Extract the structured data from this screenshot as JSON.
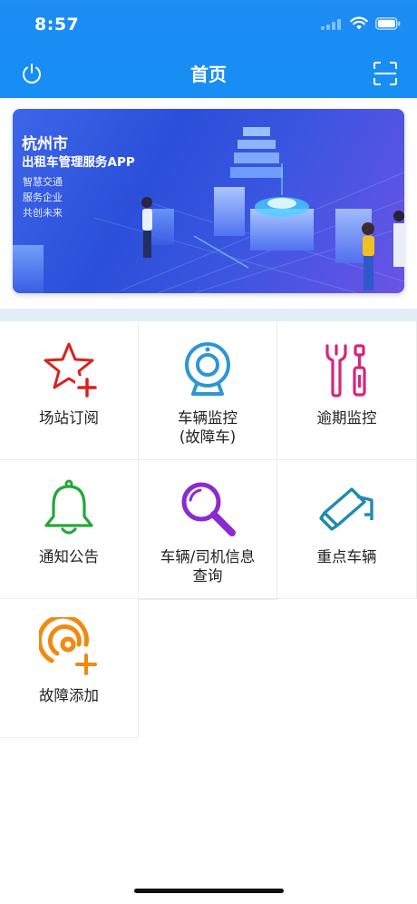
{
  "status_bar": {
    "time": "8:57"
  },
  "nav": {
    "title": "首页",
    "left_icon": "power-icon",
    "right_icon": "scan-icon"
  },
  "banner": {
    "title": "杭州市",
    "subtitle": "出租车管理服务APP",
    "lines": [
      "智慧交通",
      "服务企业",
      "共创未来"
    ]
  },
  "menu": [
    {
      "label": "场站订阅",
      "icon": "star-plus-icon",
      "color": "#d8231c"
    },
    {
      "label": "车辆监控\n(故障车)",
      "icon": "camera-icon",
      "color": "#2c97d4"
    },
    {
      "label": "逾期监控",
      "icon": "tools-icon",
      "color": "#d6257c"
    },
    {
      "label": "通知公告",
      "icon": "bell-icon",
      "color": "#25a63a"
    },
    {
      "label": "车辆/司机信息\n查询",
      "icon": "search-icon",
      "color": "#8b2ad0"
    },
    {
      "label": "重点车辆",
      "icon": "cctv-camera-icon",
      "color": "#1e8bb0"
    },
    {
      "label": "故障添加",
      "icon": "broadcast-plus-icon",
      "color": "#f08a10"
    }
  ]
}
